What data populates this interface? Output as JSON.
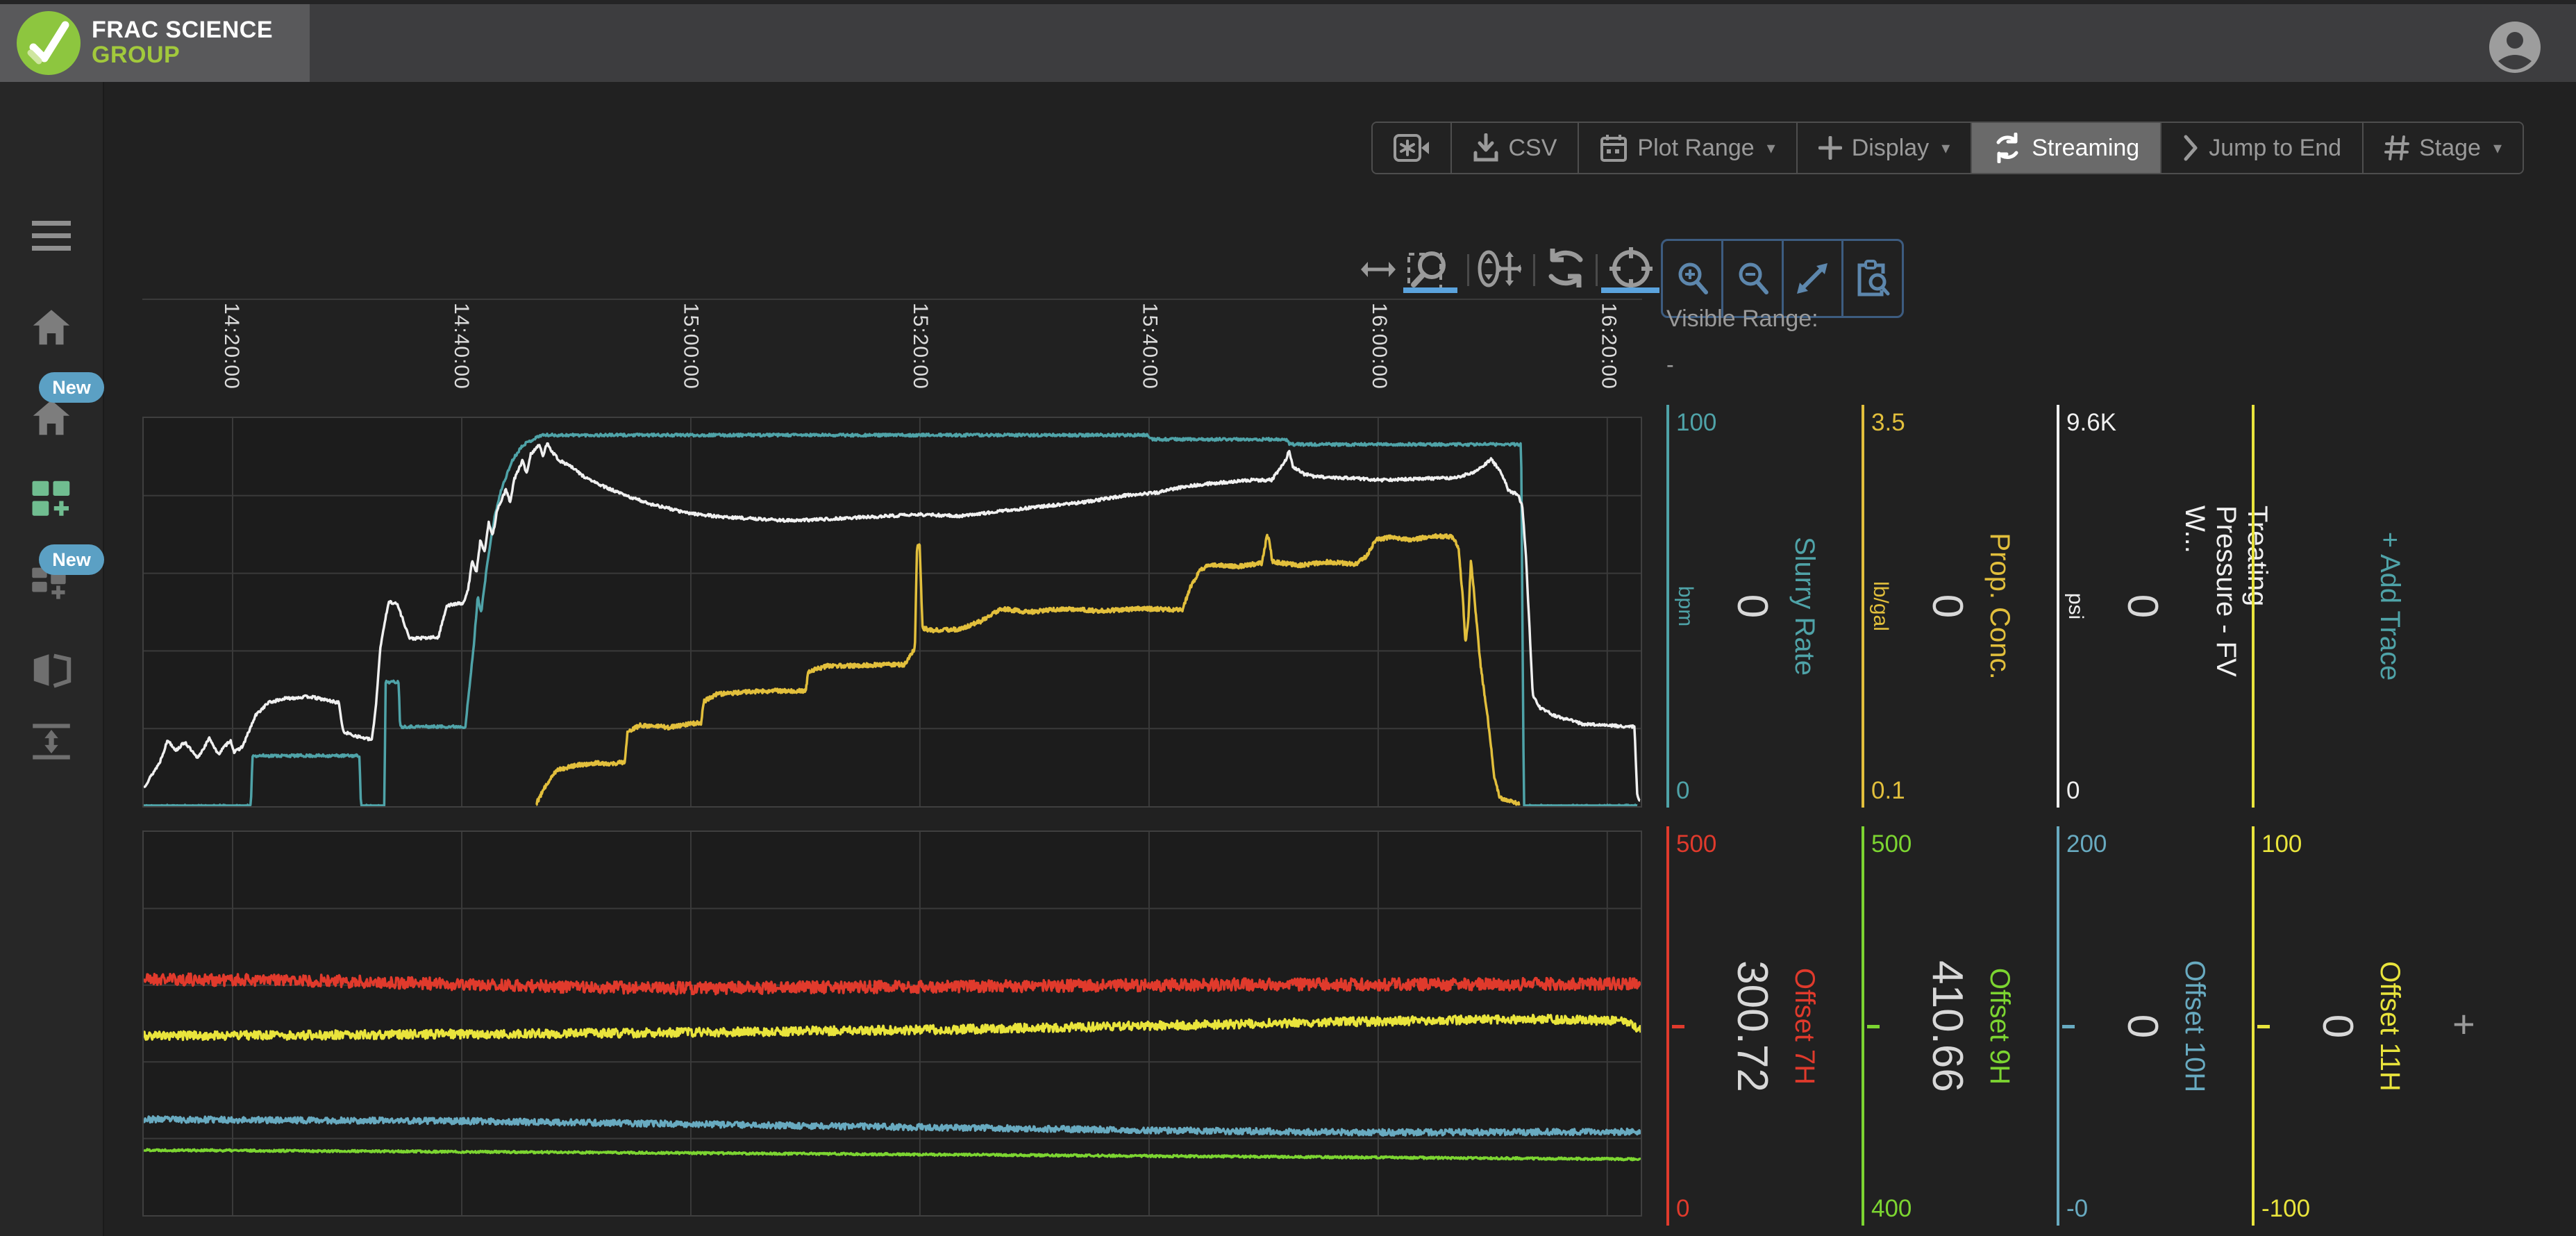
{
  "header": {
    "brand_line1": "FRAC SCIENCE",
    "brand_line2": "GROUP"
  },
  "sidebar": {
    "badge_label": "New"
  },
  "toolbar": {
    "buttons": [
      {
        "label": "",
        "icon": "record"
      },
      {
        "label": "CSV",
        "icon": "download"
      },
      {
        "label": "Plot Range",
        "icon": "calendar",
        "caret": "▾"
      },
      {
        "label": "Display",
        "icon": "plus",
        "caret": "▾"
      },
      {
        "label": "Streaming",
        "icon": "refresh",
        "active": true
      },
      {
        "label": "Jump to End",
        "icon": "chevron-right"
      },
      {
        "label": "Stage",
        "icon": "hash",
        "caret": "▾"
      }
    ]
  },
  "visible_range": {
    "label": "Visible Range:",
    "value": "-"
  },
  "colors": {
    "teal": "#4fa3a8",
    "gold": "#e2bf3c",
    "white": "#f0f0f0",
    "red": "#e03a2c",
    "green": "#7cd531",
    "blue": "#68aac0",
    "yellow": "#e9e43c",
    "grid": "#3a3a3a",
    "value_text": "#d8d8d8",
    "icon_gray": "#9a9a9a",
    "blue_tool": "#5d87ad",
    "underline_blue": "#5ba3dd",
    "badge": "#5ba0c4",
    "sidebar_active_green": "#70bd90"
  },
  "chart_data": [
    {
      "type": "line",
      "title": "",
      "x_axis": {
        "tick_labels": [
          "14:20:00",
          "14:40:00",
          "15:00:00",
          "15:20:00",
          "15:40:00",
          "16:00:00",
          "16:20:00"
        ],
        "tick_hours": [
          14.3333,
          14.6667,
          15.0,
          15.3333,
          15.6667,
          16.0,
          16.3333
        ],
        "start_hours": 14.204,
        "end_hours": 16.382
      },
      "grid": true,
      "add_trace_label": "+ Add Trace",
      "traces": [
        {
          "name": "Slurry Rate",
          "unit": "bpm",
          "color_key": "teal",
          "axis_min": 0,
          "axis_max": 100,
          "axis_min_label": "0",
          "axis_max_label": "100",
          "current_value": "0",
          "noise": 0.35,
          "seed": 11,
          "points": [
            [
              14.204,
              0
            ],
            [
              14.36,
              0
            ],
            [
              14.362,
              13
            ],
            [
              14.518,
              13
            ],
            [
              14.52,
              0
            ],
            [
              14.554,
              0
            ],
            [
              14.556,
              32
            ],
            [
              14.575,
              32
            ],
            [
              14.577,
              20.5
            ],
            [
              14.672,
              20.5
            ],
            [
              14.684,
              41
            ],
            [
              14.69,
              54
            ],
            [
              14.695,
              50
            ],
            [
              14.705,
              64
            ],
            [
              14.715,
              75
            ],
            [
              14.725,
              82
            ],
            [
              14.74,
              89
            ],
            [
              14.755,
              93
            ],
            [
              14.782,
              95.6
            ],
            [
              15.664,
              95.6
            ],
            [
              15.669,
              94.5
            ],
            [
              15.866,
              94.5
            ],
            [
              15.871,
              93.2
            ],
            [
              16.208,
              93.2
            ],
            [
              16.212,
              0
            ],
            [
              16.377,
              0
            ]
          ]
        },
        {
          "name": "Prop. Conc.",
          "unit": "lb/gal",
          "color_key": "gold",
          "axis_min": 0.1,
          "axis_max": 3.5,
          "axis_min_label": "0.1",
          "axis_max_label": "3.5",
          "current_value": "0",
          "noise": 0.018,
          "seed": 12,
          "points": [
            [
              14.775,
              0.12
            ],
            [
              14.78,
              0.18
            ],
            [
              14.795,
              0.34
            ],
            [
              14.805,
              0.42
            ],
            [
              14.836,
              0.46
            ],
            [
              14.866,
              0.48
            ],
            [
              14.886,
              0.47
            ],
            [
              14.904,
              0.49
            ],
            [
              14.908,
              0.75
            ],
            [
              14.927,
              0.81
            ],
            [
              14.967,
              0.79
            ],
            [
              14.997,
              0.82
            ],
            [
              15.015,
              0.83
            ],
            [
              15.019,
              1.02
            ],
            [
              15.037,
              1.08
            ],
            [
              15.078,
              1.1
            ],
            [
              15.118,
              1.11
            ],
            [
              15.149,
              1.11
            ],
            [
              15.167,
              1.11
            ],
            [
              15.171,
              1.28
            ],
            [
              15.199,
              1.33
            ],
            [
              15.24,
              1.33
            ],
            [
              15.28,
              1.34
            ],
            [
              15.311,
              1.34
            ],
            [
              15.326,
              1.48
            ],
            [
              15.329,
              2.38
            ],
            [
              15.333,
              2.38
            ],
            [
              15.337,
              1.66
            ],
            [
              15.351,
              1.64
            ],
            [
              15.391,
              1.65
            ],
            [
              15.422,
              1.72
            ],
            [
              15.452,
              1.83
            ],
            [
              15.492,
              1.8
            ],
            [
              15.543,
              1.83
            ],
            [
              15.594,
              1.81
            ],
            [
              15.654,
              1.83
            ],
            [
              15.715,
              1.82
            ],
            [
              15.727,
              2.02
            ],
            [
              15.74,
              2.16
            ],
            [
              15.755,
              2.22
            ],
            [
              15.796,
              2.2
            ],
            [
              15.831,
              2.23
            ],
            [
              15.838,
              2.46
            ],
            [
              15.841,
              2.46
            ],
            [
              15.846,
              2.24
            ],
            [
              15.887,
              2.21
            ],
            [
              15.927,
              2.24
            ],
            [
              15.968,
              2.22
            ],
            [
              15.983,
              2.29
            ],
            [
              15.996,
              2.43
            ],
            [
              16.018,
              2.46
            ],
            [
              16.048,
              2.43
            ],
            [
              16.079,
              2.47
            ],
            [
              16.109,
              2.46
            ],
            [
              16.117,
              2.35
            ],
            [
              16.123,
              1.93
            ],
            [
              16.127,
              1.53
            ],
            [
              16.131,
              1.71
            ],
            [
              16.135,
              2.26
            ],
            [
              16.14,
              1.93
            ],
            [
              16.149,
              1.33
            ],
            [
              16.159,
              0.89
            ],
            [
              16.169,
              0.36
            ],
            [
              16.177,
              0.17
            ],
            [
              16.205,
              0.12
            ]
          ]
        },
        {
          "name": "Treating Pressure - FV W...",
          "unit": "psi",
          "color_key": "white",
          "axis_min": 0,
          "axis_max": 9600,
          "axis_min_label": "0",
          "axis_max_label": "9.6K",
          "current_value": "0",
          "noise": 35,
          "seed": 13,
          "points": [
            [
              14.204,
              460
            ],
            [
              14.227,
              1074
            ],
            [
              14.239,
              1637
            ],
            [
              14.251,
              1381
            ],
            [
              14.264,
              1586
            ],
            [
              14.282,
              1177
            ],
            [
              14.3,
              1688
            ],
            [
              14.312,
              1279
            ],
            [
              14.33,
              1637
            ],
            [
              14.336,
              1330
            ],
            [
              14.348,
              1483
            ],
            [
              14.367,
              2251
            ],
            [
              14.385,
              2558
            ],
            [
              14.409,
              2660
            ],
            [
              14.445,
              2712
            ],
            [
              14.488,
              2558
            ],
            [
              14.494,
              1842
            ],
            [
              14.512,
              1739
            ],
            [
              14.536,
              1637
            ],
            [
              14.542,
              2507
            ],
            [
              14.548,
              3888
            ],
            [
              14.554,
              4502
            ],
            [
              14.561,
              5064
            ],
            [
              14.573,
              4996
            ],
            [
              14.591,
              4143
            ],
            [
              14.633,
              4177
            ],
            [
              14.639,
              4604
            ],
            [
              14.645,
              4962
            ],
            [
              14.67,
              5030
            ],
            [
              14.676,
              5371
            ],
            [
              14.682,
              6087
            ],
            [
              14.688,
              5780
            ],
            [
              14.694,
              6599
            ],
            [
              14.7,
              6292
            ],
            [
              14.706,
              7008
            ],
            [
              14.712,
              6701
            ],
            [
              14.718,
              7315
            ],
            [
              14.731,
              7827
            ],
            [
              14.737,
              7520
            ],
            [
              14.743,
              8082
            ],
            [
              14.755,
              8543
            ],
            [
              14.761,
              8236
            ],
            [
              14.767,
              8696
            ],
            [
              14.779,
              8952
            ],
            [
              14.785,
              8645
            ],
            [
              14.791,
              9003
            ],
            [
              14.797,
              8798
            ],
            [
              14.809,
              8543
            ],
            [
              14.822,
              8441
            ],
            [
              14.846,
              8134
            ],
            [
              14.87,
              7929
            ],
            [
              14.906,
              7673
            ],
            [
              14.943,
              7469
            ],
            [
              14.991,
              7264
            ],
            [
              15.04,
              7162
            ],
            [
              15.088,
              7111
            ],
            [
              15.149,
              7060
            ],
            [
              15.209,
              7111
            ],
            [
              15.27,
              7162
            ],
            [
              15.331,
              7213
            ],
            [
              15.391,
              7179
            ],
            [
              15.452,
              7298
            ],
            [
              15.513,
              7418
            ],
            [
              15.573,
              7520
            ],
            [
              15.634,
              7691
            ],
            [
              15.68,
              7759
            ],
            [
              15.715,
              7895
            ],
            [
              15.755,
              7980
            ],
            [
              15.816,
              8065
            ],
            [
              15.845,
              8065
            ],
            [
              15.866,
              8577
            ],
            [
              15.87,
              8815
            ],
            [
              15.876,
              8406
            ],
            [
              15.892,
              8218
            ],
            [
              15.907,
              8150
            ],
            [
              15.958,
              8116
            ],
            [
              16.01,
              8065
            ],
            [
              16.058,
              8099
            ],
            [
              16.113,
              8116
            ],
            [
              16.139,
              8270
            ],
            [
              16.154,
              8441
            ],
            [
              16.164,
              8577
            ],
            [
              16.174,
              8372
            ],
            [
              16.184,
              8065
            ],
            [
              16.189,
              7810
            ],
            [
              16.204,
              7707
            ],
            [
              16.21,
              7383
            ],
            [
              16.215,
              6190
            ],
            [
              16.225,
              2728
            ],
            [
              16.235,
              2438
            ],
            [
              16.257,
              2234
            ],
            [
              16.298,
              2029
            ],
            [
              16.34,
              1995
            ],
            [
              16.373,
              1961
            ],
            [
              16.377,
              222
            ],
            [
              16.381,
              140
            ]
          ]
        },
        {
          "name": "",
          "unit": "",
          "color_key": "yellow",
          "axis_min_label": "",
          "axis_max_label": "",
          "empty": true
        }
      ]
    },
    {
      "type": "line",
      "title": "",
      "grid": true,
      "add_trace_label": "+",
      "traces": [
        {
          "name": "Offset 7H",
          "color_key": "red",
          "axis_min": 0,
          "axis_max": 500,
          "axis_min_label": "0",
          "axis_max_label": "500",
          "current_value": "300.72",
          "noise": 8,
          "seed": 21,
          "points": [
            [
              14.204,
              308
            ],
            [
              14.45,
              306
            ],
            [
              14.75,
              299
            ],
            [
              15.0,
              296
            ],
            [
              15.35,
              298
            ],
            [
              15.8,
              301
            ],
            [
              16.1,
              301
            ],
            [
              16.382,
              302
            ]
          ]
        },
        {
          "name": "Offset 9H",
          "color_key": "green",
          "axis_min": 400,
          "axis_max": 500,
          "axis_min_label": "400",
          "axis_max_label": "500",
          "current_value": "410.66",
          "noise": 0.28,
          "seed": 22,
          "points": [
            [
              14.204,
              417
            ],
            [
              15.2,
              416
            ],
            [
              16.382,
              414.6
            ]
          ]
        },
        {
          "name": "Offset 10H",
          "color_key": "blue",
          "axis_min": 0,
          "axis_max": 200,
          "axis_min_label": "-0",
          "axis_max_label": "200",
          "current_value": "0",
          "noise": 1.6,
          "seed": 23,
          "points": [
            [
              14.204,
              50
            ],
            [
              14.7,
              49
            ],
            [
              15.2,
              46.5
            ],
            [
              15.75,
              44
            ],
            [
              16.0,
              43.2
            ],
            [
              16.382,
              43.5
            ]
          ]
        },
        {
          "name": "Offset 11H",
          "color_key": "yellow",
          "axis_min": -100,
          "axis_max": 100,
          "axis_min_label": "-100",
          "axis_max_label": "100",
          "current_value": "0",
          "noise": 2.3,
          "seed": 24,
          "points": [
            [
              14.204,
              -6.5
            ],
            [
              14.9,
              -5
            ],
            [
              15.4,
              -3
            ],
            [
              15.9,
              0.5
            ],
            [
              16.2,
              2.3
            ],
            [
              16.3,
              2.0
            ],
            [
              16.36,
              1.0
            ],
            [
              16.382,
              -3.5
            ]
          ]
        }
      ]
    }
  ]
}
